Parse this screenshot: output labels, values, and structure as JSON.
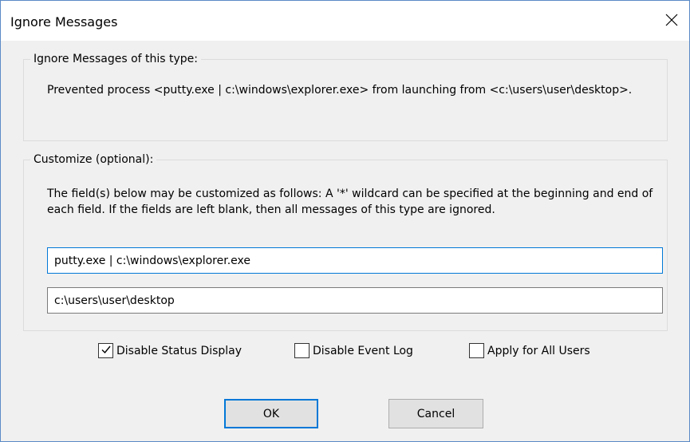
{
  "window": {
    "title": "Ignore Messages",
    "close_icon": "close-icon"
  },
  "message_group": {
    "title": "Ignore Messages of this type:",
    "text": "Prevented process <putty.exe | c:\\windows\\explorer.exe> from launching from <c:\\users\\user\\desktop>."
  },
  "customize_group": {
    "title": "Customize (optional):",
    "description": "The field(s) below may be customized as follows: A '*' wildcard can be specified at the beginning and end of each field. If the fields are left blank, then all messages of this type are ignored.",
    "process_field_value": "putty.exe | c:\\windows\\explorer.exe",
    "path_field_value": "c:\\users\\user\\desktop"
  },
  "options": [
    {
      "label": "Disable Status Display",
      "checked": true
    },
    {
      "label": "Disable Event Log",
      "checked": false
    },
    {
      "label": "Apply for All Users",
      "checked": false
    }
  ],
  "buttons": {
    "ok_label": "OK",
    "cancel_label": "Cancel"
  },
  "colors": {
    "accent": "#0078d7",
    "background": "#f0f0f0",
    "window_border": "#5a8ac6"
  }
}
